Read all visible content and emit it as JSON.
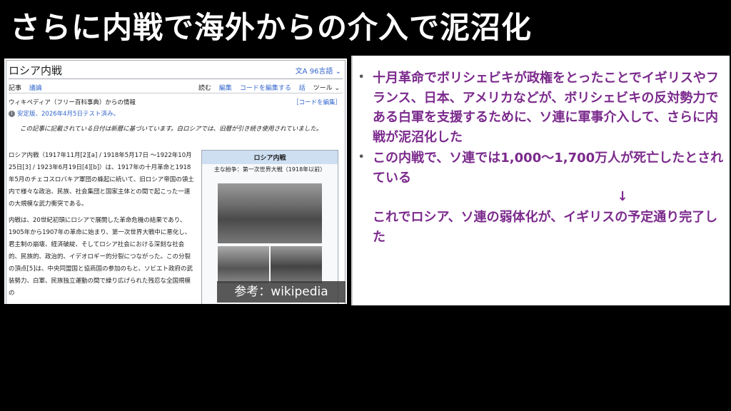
{
  "slide": {
    "title": "さらに内戦で海外からの介入で泥沼化"
  },
  "wiki": {
    "page_title": "ロシア内戦",
    "languages": "文A 96言語 ⌄",
    "tabs_left": [
      "記事",
      "議論"
    ],
    "tabs_right": [
      "読む",
      "編集",
      "コードを編集する",
      "話",
      "ツール ⌄"
    ],
    "from": "ウィキペディア（フリー百科事典）からの情報",
    "edit_code": "［コードを編集］",
    "stable": "安定版、2026年4月5日テスト済み。",
    "note": "この記事に記載されている日付は新暦に基づいています。白ロシアでは、旧暦が引き続き使用されていました。",
    "para1": "ロシア内戦（1917年11月[2][a] / 1918年5月17日 〜1922年10月25日[3] / 1923年6月19日[4][b]）は、1917年の十月革命と1918年5月のチェコスロバキア軍団の蜂起に続いて、旧ロシア帝国の領土内で様々な政治、民族、社会集団と国家主体との間で起こった一連の大規模な武力衝突である。",
    "para2": "内戦は、20世紀初頭にロシアで展開した革命危機の結果であり、1905年から1907年の革命に始まり、第一次世界大戦中に悪化し、君主制の崩壊、経済破綻、そしてロシア社会における深刻な社会的、民族的、政治的、イデオロギー的分裂につながった。この分裂の頂点[5]は、中央同盟国と協商国の参加のもと、ソビエト政府の武装勢力、白軍、民族独立運動の間で繰り広げられた残忍な全国規模の",
    "infobox": {
      "title": "ロシア内戦",
      "subtitle": "主な紛争：第一次世界大戦（1918年以前）"
    },
    "credit": "参考：wikipedia"
  },
  "bullets": [
    "十月革命でボリシェビキが政権をとったことでイギリスやフランス、日本、アメリカなどが、ボリシェビキの反対勢力である白軍を支援するために、ソ連に軍事介入して、さらに内戦が泥沼化した",
    "この内戦で、ソ連では1,000〜1,700万人が死亡したとされている"
  ],
  "arrow": "↓",
  "closing": "これでロシア、ソ連の弱体化が、イギリスの予定通り完了した",
  "colors": {
    "bullet_text": "#7b2a8c",
    "background": "#000000",
    "link": "#3366cc"
  }
}
